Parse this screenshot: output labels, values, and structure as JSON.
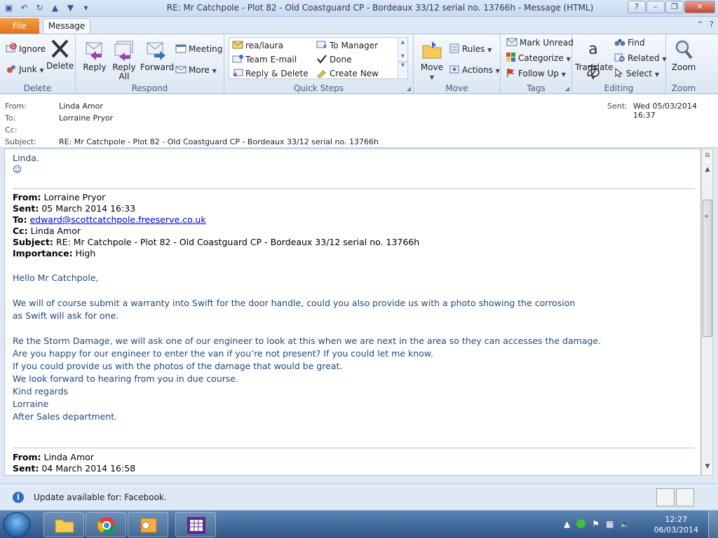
{
  "window": {
    "title": "RE: Mr Catchpole - Plot 82 - Old Coastguard CP - Bordeaux 33/12 serial no. 13766h  -  Message (HTML)"
  },
  "tabs": {
    "file": "File",
    "message": "Message"
  },
  "ribbon": {
    "delete_group": {
      "label": "Delete",
      "ignore": "Ignore",
      "junk": "Junk",
      "delete": "Delete"
    },
    "respond_group": {
      "label": "Respond",
      "reply": "Reply",
      "reply_all_1": "Reply",
      "reply_all_2": "All",
      "forward": "Forward",
      "meeting": "Meeting",
      "more": "More"
    },
    "quick_steps_group": {
      "label": "Quick Steps",
      "items": [
        "rea/laura",
        "To Manager",
        "Team E-mail",
        "Done",
        "Reply & Delete",
        "Create New"
      ]
    },
    "move_group": {
      "label": "Move",
      "move": "Move",
      "rules": "Rules",
      "actions": "Actions"
    },
    "tags_group": {
      "label": "Tags",
      "mark_unread": "Mark Unread",
      "categorize": "Categorize",
      "follow_up": "Follow Up"
    },
    "editing_group": {
      "label": "Editing",
      "translate": "Translate",
      "find": "Find",
      "related": "Related",
      "select": "Select"
    },
    "zoom_group": {
      "label": "Zoom",
      "zoom": "Zoom"
    }
  },
  "header": {
    "from_label": "From:",
    "from_value": "Linda Amor",
    "to_label": "To:",
    "to_value": "Lorraine Pryor",
    "cc_label": "Cc:",
    "subject_label": "Subject:",
    "subject_value": "RE: Mr Catchpole - Plot 82 - Old Coastguard CP - Bordeaux 33/12 serial no. 13766h",
    "sent_label": "Sent:",
    "sent_value": "Wed 05/03/2014 16:37"
  },
  "body": {
    "greeting_name": "Linda.",
    "smiley": "☺",
    "quoted1": {
      "from_label": "From:",
      "from_value": "Lorraine Pryor",
      "sent_label": "Sent:",
      "sent_value": "05 March 2014 16:33",
      "to_label": "To:",
      "to_value": "edward@scottcatchpole.freeserve.co.uk",
      "cc_label": "Cc:",
      "cc_value": "Linda Amor",
      "subject_label": "Subject:",
      "subject_value": "RE: Mr Catchpole - Plot 82 - Old Coastguard CP - Bordeaux 33/12 serial no. 13766h",
      "importance_label": "Importance:",
      "importance_value": "High"
    },
    "lines": [
      "Hello Mr Catchpole,",
      "We will of course submit a warranty into Swift for the door handle, could you also provide us with a photo showing the corrosion",
      "as Swift will ask for one.",
      "Re the Storm Damage, we will ask one of our engineer to look at this when we are next in the area so they can accesses the damage.",
      "Are you happy for our engineer to enter the van if you’re not present? If you could let me know.",
      "If you could provide us with the photos of the damage that would be great.",
      "We look forward to hearing from you in due course.",
      "Kind regards",
      "Lorraine",
      "After Sales department."
    ],
    "quoted2": {
      "from_label": "From:",
      "from_value": "Linda Amor",
      "sent_label": "Sent:",
      "sent_value": "04 March 2014 16:58"
    }
  },
  "infobar": {
    "text": "Update available for: Facebook."
  },
  "taskbar": {
    "time": "12:27",
    "date": "06/03/2014"
  }
}
